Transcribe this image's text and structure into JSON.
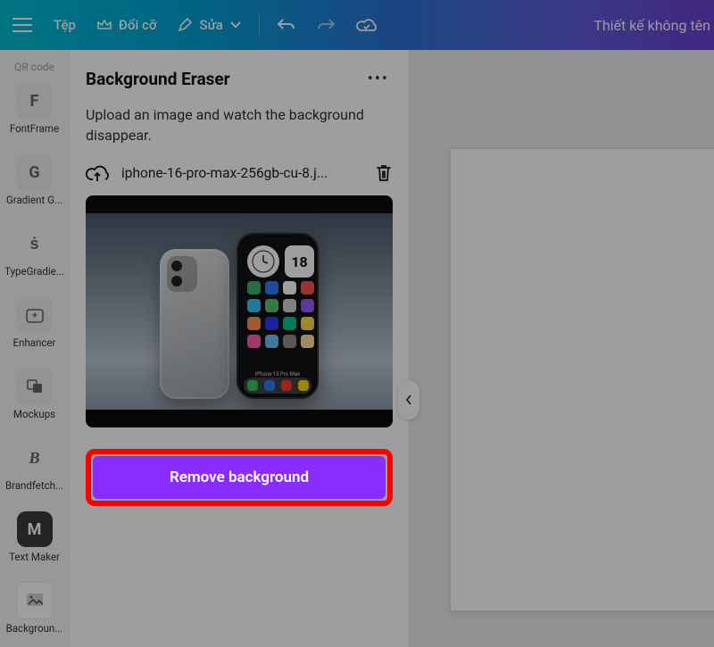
{
  "topbar": {
    "file_label": "Tệp",
    "resize_label": "Đổi cỡ",
    "edit_label": "Sửa",
    "doc_title": "Thiết kế không tên"
  },
  "sidebar": {
    "qr_label": "QR code",
    "items": [
      {
        "label": "FontFrame",
        "glyph": "F",
        "kind": "box"
      },
      {
        "label": "Gradient G...",
        "glyph": "G",
        "kind": "box"
      },
      {
        "label": "TypeGradie...",
        "glyph": "ṡ",
        "kind": "light"
      },
      {
        "label": "Enhancer",
        "glyph": "✦",
        "kind": "box"
      },
      {
        "label": "Mockups",
        "glyph": "◧",
        "kind": "box"
      },
      {
        "label": "Brandfetch...",
        "glyph": "B",
        "kind": "light"
      },
      {
        "label": "Text Maker",
        "glyph": "M",
        "kind": "dark"
      },
      {
        "label": "Backgroun...",
        "glyph": "✂",
        "kind": "selected"
      }
    ]
  },
  "panel": {
    "title": "Background Eraser",
    "subtitle": "Upload an image and watch the background disappear.",
    "file_name": "iphone-16-pro-max-256gb-cu-8.j...",
    "preview": {
      "model_text": "iPhone 15 Pro Max",
      "calendar_day": "18",
      "app_colors": [
        "#3bb273",
        "#2d7ff9",
        "#ffffff",
        "#ff4f4f",
        "#35c4ff",
        "#59c46a",
        "#d0d0d0",
        "#9b59ff",
        "#ff914d",
        "#3134ff",
        "#00c88c",
        "#ffdf3d",
        "#ff5ea1",
        "#6ec1ff",
        "#8d8d8d",
        "#ffe29a"
      ],
      "dock_colors": [
        "#34c759",
        "#2d7ff9",
        "#ff3b30",
        "#ffd60a"
      ]
    },
    "cta_label": "Remove background"
  },
  "colors": {
    "cta_bg": "#8b2cff",
    "highlight_border": "#ff0000"
  }
}
